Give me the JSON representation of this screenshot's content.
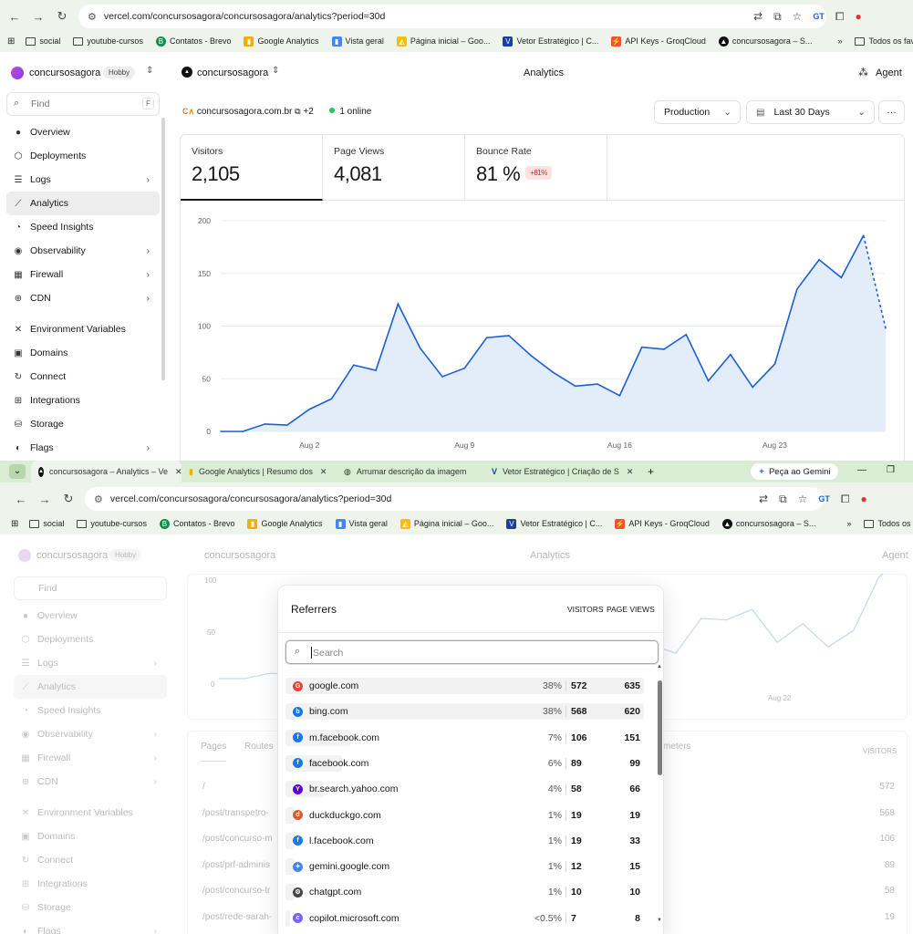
{
  "browser": {
    "url": "vercel.com/concursosagora/concursosagora/analytics?period=30d",
    "bookmarks": [
      "social",
      "youtube-cursos",
      "Contatos - Brevo",
      "Google Analytics",
      "Vista geral",
      "Página inicial – Goo...",
      "Vetor Estratégico | C...",
      "API Keys - GroqCloud",
      "concursosagora – S..."
    ],
    "bookmarks_overflow": "»",
    "all_bookmarks": "Todos os favoritos",
    "tabs": [
      "concursosagora – Analytics – Ve",
      "Google Analytics | Resumo dos",
      "Arrumar descrição da imagem",
      "Vetor Estratégico | Criação de S"
    ],
    "new_tab": "+",
    "gemini": "Peça ao Gemini",
    "minimize": "—",
    "restore": "❐"
  },
  "header": {
    "team": "concursosagora",
    "plan": "Hobby",
    "project": "concursosagora",
    "page_title": "Analytics",
    "agent": "Agent"
  },
  "sidebar": {
    "find_placeholder": "Find",
    "find_key": "F",
    "items": [
      {
        "label": "Overview",
        "icon": "●"
      },
      {
        "label": "Deployments",
        "icon": "⬡"
      },
      {
        "label": "Logs",
        "icon": "☰",
        "chev": true
      },
      {
        "label": "Analytics",
        "icon": "⟋",
        "active": true
      },
      {
        "label": "Speed Insights",
        "icon": "◔"
      },
      {
        "label": "Observability",
        "icon": "◉",
        "chev": true
      },
      {
        "label": "Firewall",
        "icon": "▦",
        "chev": true
      },
      {
        "label": "CDN",
        "icon": "⊕",
        "chev": true
      },
      {
        "label": "Environment Variables",
        "icon": "✕"
      },
      {
        "label": "Domains",
        "icon": "▣"
      },
      {
        "label": "Connect",
        "icon": "↻"
      },
      {
        "label": "Integrations",
        "icon": "⊞"
      },
      {
        "label": "Storage",
        "icon": "⛁"
      },
      {
        "label": "Flags",
        "icon": "◐",
        "chev": true
      }
    ]
  },
  "toolbar": {
    "domain": "concursosagora.com.br",
    "domain_extra": "+2",
    "online": "1 online",
    "environment": "Production",
    "period": "Last 30 Days",
    "more": "···"
  },
  "metrics": [
    {
      "label": "Visitors",
      "value": "2,105"
    },
    {
      "label": "Page Views",
      "value": "4,081"
    },
    {
      "label": "Bounce Rate",
      "value": "81 %",
      "badge": "+81%"
    }
  ],
  "colors": {
    "accent": "#1a5fd6",
    "area": "#e3edf9",
    "online": "#22c55e",
    "badge_bg": "#fde2e2",
    "badge_fg": "#d4242c"
  },
  "chart_data": {
    "type": "area",
    "yticks": [
      0,
      50,
      100,
      150,
      200
    ],
    "ylim": [
      0,
      200
    ],
    "xtick_labels": [
      "Aug 2",
      "Aug 9",
      "Aug 16",
      "Aug 23"
    ],
    "xtick_index": [
      4,
      11,
      18,
      25
    ],
    "values": [
      0,
      0,
      7,
      6,
      21,
      31,
      63,
      58,
      121,
      79,
      52,
      60,
      89,
      91,
      72,
      56,
      43,
      45,
      34,
      80,
      78,
      92,
      48,
      73,
      42,
      64,
      135,
      163,
      146,
      186,
      98
    ],
    "projected_from_index": 29,
    "grid": true
  },
  "background": {
    "chart_ticks": [
      "100",
      "50",
      "0"
    ],
    "xtick": "Aug 22",
    "tabs": [
      "Pages",
      "Routes"
    ],
    "meters_label": "meters",
    "visitors_header": "VISITORS",
    "paths": [
      "/",
      "/post/transpetro-",
      "/post/concurso-m",
      "/post/prf-adminis",
      "/post/concurso-tr",
      "/post/rede-sarah-"
    ],
    "path_counts": [
      "572",
      "568",
      "106",
      "89",
      "58",
      "19"
    ]
  },
  "referrers": {
    "title": "Referrers",
    "col_visitors": "VISITORS",
    "col_pageviews": "PAGE VIEWS",
    "search_placeholder": "Search",
    "rows": [
      {
        "host": "google.com",
        "pct": "38%",
        "visitors": "572",
        "pageviews": "635",
        "share": 0.38,
        "icon": "G",
        "color": "#ea4335"
      },
      {
        "host": "bing.com",
        "pct": "38%",
        "visitors": "568",
        "pageviews": "620",
        "share": 0.38,
        "icon": "b",
        "color": "#1a73e8"
      },
      {
        "host": "m.facebook.com",
        "pct": "7%",
        "visitors": "106",
        "pageviews": "151",
        "share": 0.07,
        "icon": "f",
        "color": "#1877f2"
      },
      {
        "host": "facebook.com",
        "pct": "6%",
        "visitors": "89",
        "pageviews": "99",
        "share": 0.06,
        "icon": "f",
        "color": "#1877f2"
      },
      {
        "host": "br.search.yahoo.com",
        "pct": "4%",
        "visitors": "58",
        "pageviews": "66",
        "share": 0.04,
        "icon": "Y",
        "color": "#6001d2"
      },
      {
        "host": "duckduckgo.com",
        "pct": "1%",
        "visitors": "19",
        "pageviews": "19",
        "share": 0.01,
        "icon": "d",
        "color": "#de5833"
      },
      {
        "host": "l.facebook.com",
        "pct": "1%",
        "visitors": "19",
        "pageviews": "33",
        "share": 0.01,
        "icon": "f",
        "color": "#1877f2"
      },
      {
        "host": "gemini.google.com",
        "pct": "1%",
        "visitors": "12",
        "pageviews": "15",
        "share": 0.01,
        "icon": "✦",
        "color": "#4285f4"
      },
      {
        "host": "chatgpt.com",
        "pct": "1%",
        "visitors": "10",
        "pageviews": "10",
        "share": 0.01,
        "icon": "⚙",
        "color": "#444444"
      },
      {
        "host": "copilot.microsoft.com",
        "pct": "<0.5%",
        "visitors": "7",
        "pageviews": "8",
        "share": 0.005,
        "icon": "c",
        "color": "#7b61ff"
      }
    ]
  }
}
